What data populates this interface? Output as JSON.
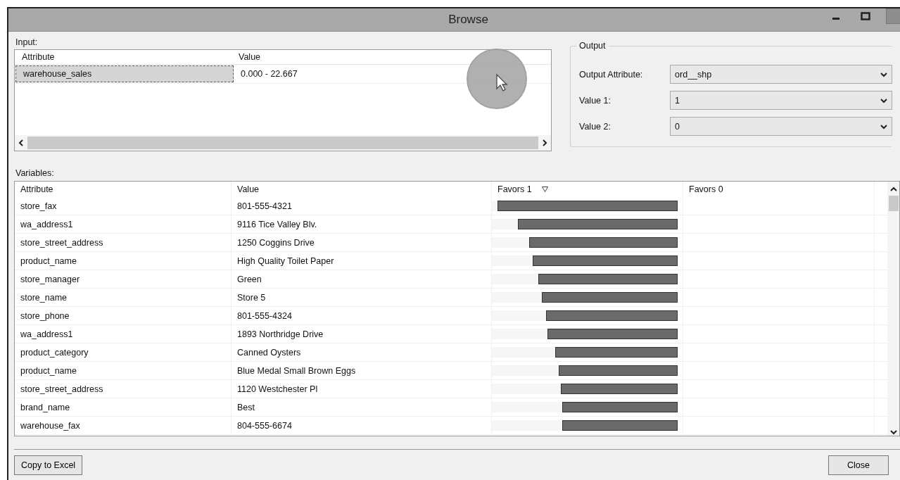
{
  "window": {
    "title": "Browse"
  },
  "input": {
    "label": "Input:",
    "columns": [
      "Attribute",
      "Value"
    ],
    "rows": [
      {
        "attribute": "warehouse_sales",
        "value": "0.000 - 22.667",
        "selected": true
      }
    ]
  },
  "output": {
    "title": "Output",
    "fields": [
      {
        "label": "Output Attribute:",
        "value": "ord__shp"
      },
      {
        "label": "Value 1:",
        "value": "1"
      },
      {
        "label": "Value 2:",
        "value": "0"
      }
    ]
  },
  "variables": {
    "label": "Variables:",
    "columns": [
      {
        "label": "Attribute",
        "sorted": false
      },
      {
        "label": "Value",
        "sorted": false
      },
      {
        "label": "Favors 1",
        "sorted": true
      },
      {
        "label": "Favors 0",
        "sorted": false
      }
    ],
    "rows": [
      {
        "attribute": "store_fax",
        "value": "801-555-4321",
        "level": 0.97
      },
      {
        "attribute": "wa_address1",
        "value": "9116 Tice Valley Blv.",
        "level": 0.86
      },
      {
        "attribute": "store_street_address",
        "value": "1250 Coggins Drive",
        "level": 0.8
      },
      {
        "attribute": "product_name",
        "value": "High Quality Toilet Paper",
        "level": 0.78
      },
      {
        "attribute": "store_manager",
        "value": "Green",
        "level": 0.75
      },
      {
        "attribute": "store_name",
        "value": "Store 5",
        "level": 0.73
      },
      {
        "attribute": "store_phone",
        "value": "801-555-4324",
        "level": 0.71
      },
      {
        "attribute": "wa_address1",
        "value": "1893 Northridge Drive",
        "level": 0.7
      },
      {
        "attribute": "product_category",
        "value": "Canned Oysters",
        "level": 0.66
      },
      {
        "attribute": "product_name",
        "value": "Blue Medal Small Brown Eggs",
        "level": 0.64
      },
      {
        "attribute": "store_street_address",
        "value": "1120 Westchester Pl",
        "level": 0.63
      },
      {
        "attribute": "brand_name",
        "value": "Best",
        "level": 0.62
      },
      {
        "attribute": "warehouse_fax",
        "value": "804-555-6674",
        "level": 0.62
      }
    ]
  },
  "buttons": [
    "Copy to Excel",
    "Close"
  ]
}
